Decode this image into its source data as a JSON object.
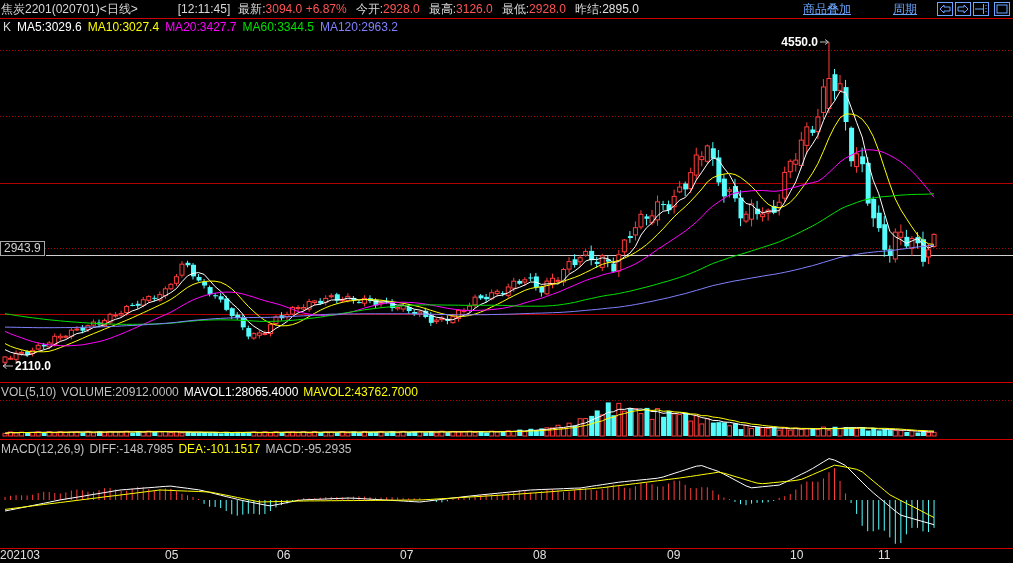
{
  "header": {
    "instrument": "焦炭2201(020701)<日线>",
    "time": "[12:11:45]",
    "quotes": [
      {
        "label": "最新:",
        "value": "3094.0 +6.87%",
        "color": "#ff5454"
      },
      {
        "label": "今开:",
        "value": "2928.0",
        "color": "#ff5454"
      },
      {
        "label": "最高:",
        "value": "3126.0",
        "color": "#ff5454"
      },
      {
        "label": "最低:",
        "value": "2928.0",
        "color": "#ff5454"
      },
      {
        "label": "昨结:",
        "value": "2895.0",
        "color": "#e0e0e0"
      }
    ],
    "links": [
      "商品叠加",
      "周期"
    ]
  },
  "price_pane": {
    "title": "K",
    "indicators": [
      {
        "label": "MA5:3029.6",
        "color": "#ffffff"
      },
      {
        "label": "MA10:3027.4",
        "color": "#ffff00"
      },
      {
        "label": "MA20:3427.7",
        "color": "#ff00ff"
      },
      {
        "label": "MA60:3344.5",
        "color": "#00e000"
      },
      {
        "label": "MA120:2963.2",
        "color": "#8080ff"
      }
    ],
    "price_tag": "2943.9",
    "high_marker": "4550.0",
    "low_marker": "2110.0"
  },
  "volume_pane": {
    "title": "VOL(5,10)",
    "indicators": [
      {
        "label": "VOLUME:20912.0000",
        "color": "#c0c0c0"
      },
      {
        "label": "MAVOL1:28065.4000",
        "color": "#ffffff"
      },
      {
        "label": "MAVOL2:43762.7000",
        "color": "#ffff00"
      }
    ]
  },
  "macd_pane": {
    "title": "MACD(12,26,9)",
    "indicators": [
      {
        "label": "DIFF:-148.7985",
        "color": "#c0c0c0"
      },
      {
        "label": "DEA:-101.1517",
        "color": "#ffff00"
      },
      {
        "label": "MACD:-95.2935",
        "color": "#c0c0c0"
      }
    ]
  },
  "x_axis": {
    "labels": [
      "202103",
      "05",
      "06",
      "07",
      "08",
      "09",
      "10",
      "11"
    ]
  }
}
